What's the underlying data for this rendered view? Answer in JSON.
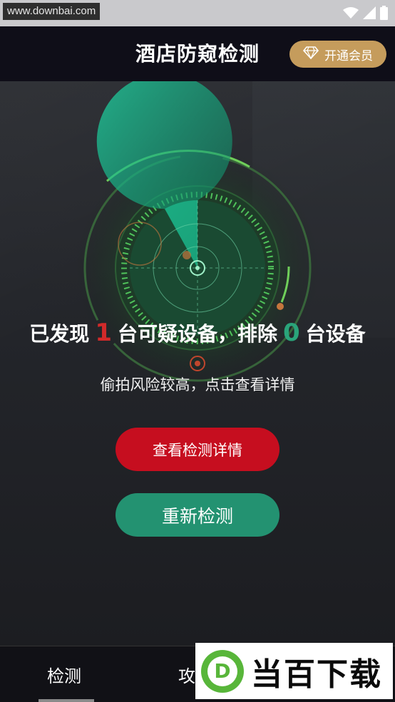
{
  "status_bar": {
    "watermark_url": "www.downbai.com",
    "icons": [
      "wifi-icon",
      "signal-icon",
      "battery-icon"
    ]
  },
  "header": {
    "title": "酒店防窥检测",
    "vip_button": {
      "label": "开通会员",
      "icon": "diamond-icon"
    }
  },
  "scan": {
    "found_prefix": "已发现",
    "suspicious_count": "1",
    "found_middle": "台可疑设备，排除",
    "excluded_count": "0",
    "found_suffix": "台设备",
    "subtitle": "偷拍风险较高，点击查看详情"
  },
  "actions": {
    "details_label": "查看检测详情",
    "rescan_label": "重新检测"
  },
  "bottom_nav": {
    "tabs": [
      {
        "label": "检测",
        "active": true
      },
      {
        "label": "攻略",
        "active": false
      }
    ]
  },
  "watermark_logo": {
    "letter": "D",
    "text": "当百下载"
  },
  "colors": {
    "accent_red": "#c60e1f",
    "accent_green": "#239271",
    "vip_gold": "#c59c5c",
    "header_bg": "#0f0e18"
  }
}
